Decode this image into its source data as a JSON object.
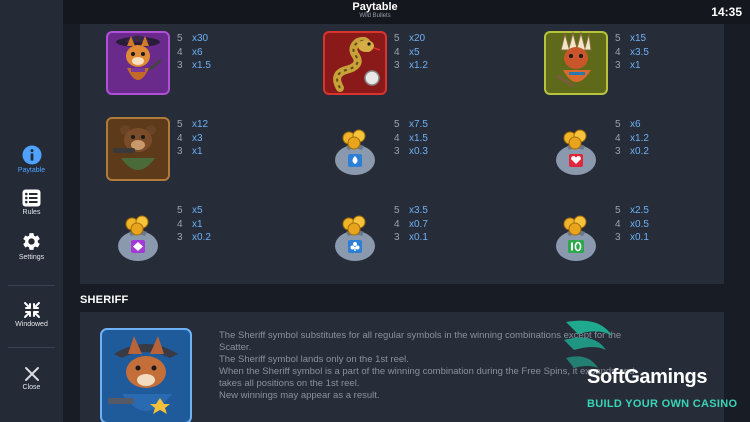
{
  "header": {
    "title": "Paytable",
    "subtitle": "Wild Bullets",
    "time": "14:35"
  },
  "sidebar": {
    "items": [
      {
        "label": "Paytable",
        "icon": "info-icon",
        "active": true
      },
      {
        "label": "Rules",
        "icon": "list-icon"
      },
      {
        "label": "Settings",
        "icon": "gear-icon"
      },
      {
        "label": "Windowed",
        "icon": "collapse-icon"
      },
      {
        "label": "Close",
        "icon": "close-icon"
      }
    ]
  },
  "paytable": {
    "symbols": [
      {
        "name": "fox-bandit-symbol",
        "pays": [
          [
            "5",
            "x30"
          ],
          [
            "4",
            "x6"
          ],
          [
            "3",
            "x1.5"
          ]
        ]
      },
      {
        "name": "rattlesnake-symbol",
        "pays": [
          [
            "5",
            "x20"
          ],
          [
            "4",
            "x5"
          ],
          [
            "3",
            "x1.2"
          ]
        ]
      },
      {
        "name": "chief-symbol",
        "pays": [
          [
            "5",
            "x15"
          ],
          [
            "4",
            "x3.5"
          ],
          [
            "3",
            "x1"
          ]
        ]
      },
      {
        "name": "bear-symbol",
        "pays": [
          [
            "5",
            "x12"
          ],
          [
            "4",
            "x3"
          ],
          [
            "3",
            "x1"
          ]
        ]
      },
      {
        "name": "spade-bag-symbol",
        "pays": [
          [
            "5",
            "x7.5"
          ],
          [
            "4",
            "x1.5"
          ],
          [
            "3",
            "x0.3"
          ]
        ]
      },
      {
        "name": "heart-bag-symbol",
        "pays": [
          [
            "5",
            "x6"
          ],
          [
            "4",
            "x1.2"
          ],
          [
            "3",
            "x0.2"
          ]
        ]
      },
      {
        "name": "diamond-bag-symbol",
        "pays": [
          [
            "5",
            "x5"
          ],
          [
            "4",
            "x1"
          ],
          [
            "3",
            "x0.2"
          ]
        ]
      },
      {
        "name": "club-bag-symbol",
        "pays": [
          [
            "5",
            "x3.5"
          ],
          [
            "4",
            "x0.7"
          ],
          [
            "3",
            "x0.1"
          ]
        ]
      },
      {
        "name": "ten-bag-symbol",
        "pays": [
          [
            "5",
            "x2.5"
          ],
          [
            "4",
            "x0.5"
          ],
          [
            "3",
            "x0.1"
          ]
        ]
      }
    ]
  },
  "sheriff": {
    "heading": "SHERIFF",
    "lines": [
      "The Sheriff symbol substitutes for all regular symbols in the winning combinations except for the",
      "Scatter.",
      "The Sheriff symbol lands only on the 1st reel.",
      "When the Sheriff symbol is a part of the winning combination during the Free Spins, it expands and",
      "takes all positions on the 1st reel.",
      "New winnings may appear as a result."
    ]
  },
  "watermark": {
    "name": "SoftGamings",
    "tagline": "BUILD YOUR OWN CASINO"
  },
  "colors": {
    "accent": "#4fa3ff",
    "multiplier": "#6fb1f5",
    "panel": "#262c38",
    "sidebar": "#242a36"
  }
}
